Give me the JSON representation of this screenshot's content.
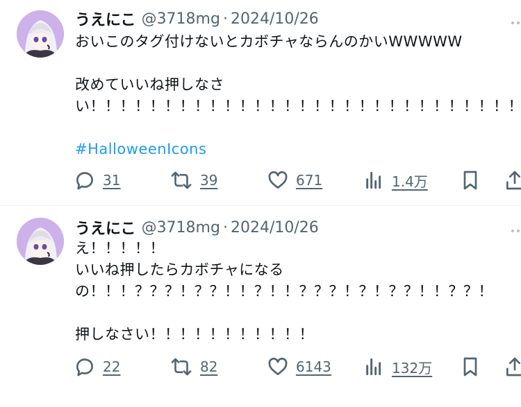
{
  "tweets": [
    {
      "name": "うえにこ",
      "handle": "@3718mg",
      "sep": "·",
      "date": "2024/10/26",
      "lines": [
        "おいこのタグ付けないとカボチャならんのかいWWWWW",
        "",
        "改めていいね押しなさ",
        "い！！！！！！！！！！！！！！！！！！！！！！！！！！！！！！"
      ],
      "hashtag": "#HalloweenIcons",
      "replies": "31",
      "reposts": "39",
      "likes": "671",
      "views": "1.4万"
    },
    {
      "name": "うえにこ",
      "handle": "@3718mg",
      "sep": "·",
      "date": "2024/10/26",
      "lines": [
        "え！！！！！",
        "いいね押したらカボチャになる",
        "の！！！？？？！？？！！？！！？？？！？！？？！！？？！",
        "",
        "押しなさい！！！！！！！！！！！"
      ],
      "replies": "22",
      "reposts": "82",
      "likes": "6143",
      "views": "132万"
    }
  ],
  "icons": {
    "reply": "reply-icon",
    "repost": "repost-icon",
    "like": "heart-icon",
    "views": "views-icon",
    "bookmark": "bookmark-icon",
    "share": "share-icon",
    "more": "more-icon"
  },
  "colors": {
    "text": "#0f1419",
    "secondary": "#536471",
    "link": "#1d9bf0",
    "avatar_bg": "#c9a9e6"
  }
}
